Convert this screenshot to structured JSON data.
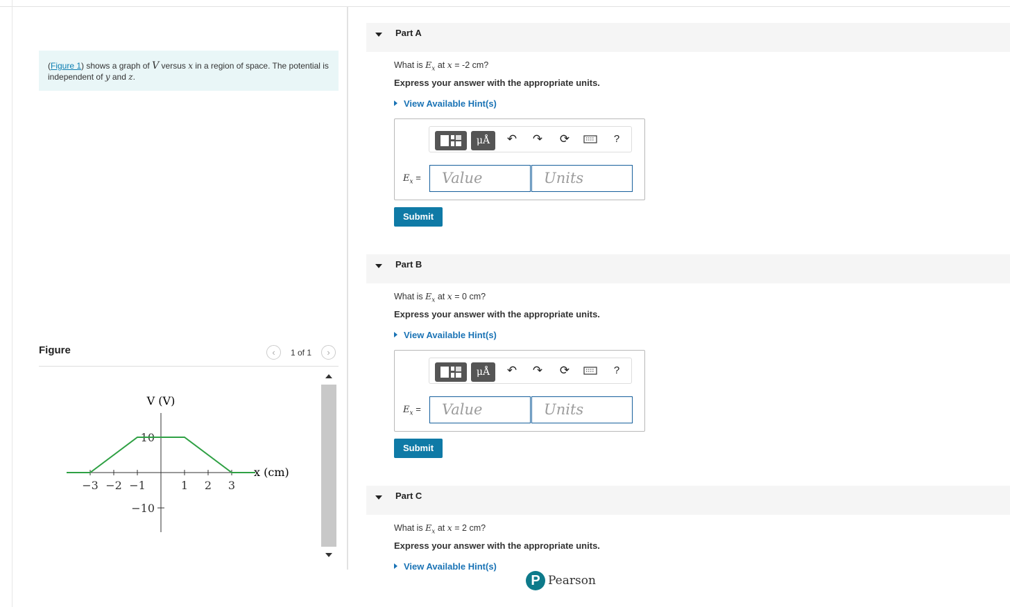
{
  "intro": {
    "figure_link": "Figure 1",
    "text_1": ") shows a graph of ",
    "var_v": "V",
    "text_2": " versus ",
    "var_x": "x",
    "text_3": " in a region of space. The potential is independent of ",
    "var_y": "y",
    "text_4": " and ",
    "var_z": "z",
    "text_5": "."
  },
  "figure": {
    "title": "Figure",
    "pager": "1 of 1",
    "prev_icon": "chevron-left-icon",
    "next_icon": "chevron-right-icon"
  },
  "chart_data": {
    "type": "line",
    "x": [
      -4,
      -3,
      -1,
      1,
      3,
      4
    ],
    "y": [
      0,
      0,
      10,
      10,
      0,
      0
    ],
    "xlabel": "x (cm)",
    "ylabel": "V (V)",
    "x_ticks": [
      "−3",
      "−2",
      "−1",
      "1",
      "2",
      "3"
    ],
    "y_ticks": [
      "10",
      "−10"
    ],
    "line_color": "#2ea043"
  },
  "parts": [
    {
      "title": "Part A",
      "q_prefix": "What is ",
      "q_var": "E",
      "q_sub": "x",
      "q_mid": " at ",
      "q_xvar": "x",
      "q_value": " = -2 cm?",
      "express": "Express your answer with the appropriate units.",
      "hint": "View Available Hint(s)",
      "label_var": "E",
      "label_sub": "x",
      "label_eq": " =",
      "value_placeholder": "Value",
      "units_placeholder": "Units",
      "submit": "Submit"
    },
    {
      "title": "Part B",
      "q_prefix": "What is ",
      "q_var": "E",
      "q_sub": "x",
      "q_mid": " at ",
      "q_xvar": "x",
      "q_value": " = 0 cm?",
      "express": "Express your answer with the appropriate units.",
      "hint": "View Available Hint(s)",
      "label_var": "E",
      "label_sub": "x",
      "label_eq": " =",
      "value_placeholder": "Value",
      "units_placeholder": "Units",
      "submit": "Submit"
    },
    {
      "title": "Part C",
      "q_prefix": "What is ",
      "q_var": "E",
      "q_sub": "x",
      "q_mid": " at ",
      "q_xvar": "x",
      "q_value": " = 2 cm?",
      "express": "Express your answer with the appropriate units.",
      "hint": "View Available Hint(s)"
    }
  ],
  "toolbar": {
    "units_button": "μÅ",
    "templates_icon": "templates-icon",
    "undo_icon": "undo-icon",
    "redo_icon": "redo-icon",
    "reset_icon": "reset-icon",
    "keyboard_icon": "keyboard-icon",
    "help_label": "?"
  },
  "footer": {
    "brand": "Pearson",
    "logo_letter": "P"
  }
}
